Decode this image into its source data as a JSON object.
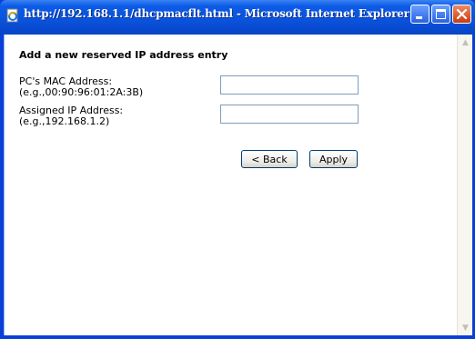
{
  "window": {
    "title": "http://192.168.1.1/dhcpmacflt.html - Microsoft Internet Explorer",
    "icon": "ie-page-icon",
    "controls": [
      "minimize-icon",
      "maximize-icon",
      "close-icon"
    ]
  },
  "form": {
    "heading": "Add a new reserved IP address entry",
    "mac": {
      "label": "PC's MAC Address:",
      "example": "(e.g.,00:90:96:01:2A:3B)",
      "value": "",
      "placeholder": ""
    },
    "ip": {
      "label": "Assigned IP Address:",
      "example": "(e.g.,192.168.1.2)",
      "value": "",
      "placeholder": ""
    },
    "back_label": "< Back",
    "apply_label": "Apply"
  },
  "colors": {
    "titlebar": "#0a52dc",
    "close_button": "#c93c12",
    "input_border": "#7f9db9",
    "button_border": "#003c74"
  }
}
